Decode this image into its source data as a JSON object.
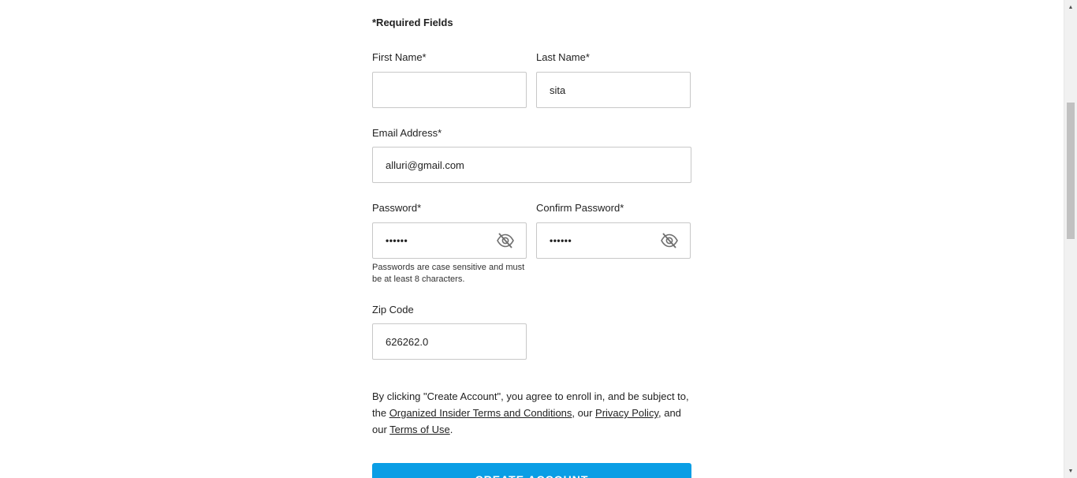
{
  "form": {
    "required_note": "*Required Fields",
    "first_name": {
      "label": "First Name*",
      "value": ""
    },
    "last_name": {
      "label": "Last Name*",
      "value": "sita"
    },
    "email": {
      "label": "Email Address*",
      "value": "alluri@gmail.com"
    },
    "password": {
      "label": "Password*",
      "value": "••••••",
      "hint": "Passwords are case sensitive and must be at least 8 characters."
    },
    "confirm_password": {
      "label": "Confirm Password*",
      "value": "••••••"
    },
    "zip": {
      "label": "Zip Code",
      "value": "626262.0"
    },
    "terms": {
      "prefix": "By clicking \"Create Account\", you agree to enroll in, and be subject to, the ",
      "link_insider": "Organized Insider Terms and Conditions",
      "mid1": ", our ",
      "link_privacy": "Privacy Policy",
      "mid2": ", and our ",
      "link_terms": "Terms of Use",
      "suffix": "."
    },
    "submit_label": "CREATE ACCOUNT"
  },
  "icons": {
    "password_toggle": "eye-slash-icon",
    "confirm_toggle": "eye-slash-icon"
  },
  "colors": {
    "button": "#0a9ee5",
    "border": "#c8c8c8"
  }
}
